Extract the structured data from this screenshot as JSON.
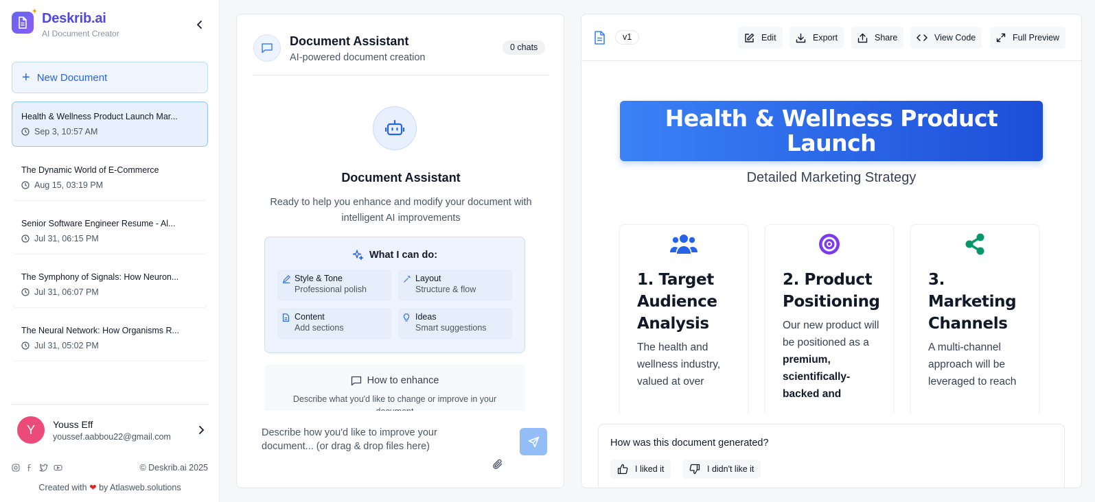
{
  "brand": {
    "name": "Deskrib.ai",
    "tagline": "AI Document Creator"
  },
  "sidebar": {
    "new_document_label": "New Document",
    "documents": [
      {
        "title": "Health & Wellness Product Launch Mar...",
        "date": "Sep 3, 10:57 AM"
      },
      {
        "title": "The Dynamic World of E-Commerce",
        "date": "Aug 15, 03:19 PM"
      },
      {
        "title": "Senior Software Engineer Resume - Al...",
        "date": "Jul 31, 06:15 PM"
      },
      {
        "title": "The Symphony of Signals: How Neuron...",
        "date": "Jul 31, 06:07 PM"
      },
      {
        "title": "The Neural Network: How Organisms R...",
        "date": "Jul 31, 05:02 PM"
      }
    ],
    "user": {
      "initial": "Y",
      "name": "Youss Eff",
      "email": "youssef.aabbou22@gmail.com"
    },
    "social_icons": [
      "instagram-icon",
      "facebook-icon",
      "twitter-icon",
      "youtube-icon"
    ],
    "copyright": "© Deskrib.ai 2025",
    "created_prefix": "Created with",
    "created_suffix": "by Atlasweb.solutions"
  },
  "assistant": {
    "title": "Document Assistant",
    "subtitle": "AI-powered document creation",
    "chat_count": "0 chats",
    "center_title": "Document Assistant",
    "center_description": "Ready to help you enhance and modify your document with intelligent AI improvements",
    "capabilities_heading": "What I can do:",
    "capabilities": [
      {
        "title": "Style & Tone",
        "subtitle": "Professional polish"
      },
      {
        "title": "Layout",
        "subtitle": "Structure & flow"
      },
      {
        "title": "Content",
        "subtitle": "Add sections"
      },
      {
        "title": "Ideas",
        "subtitle": "Smart suggestions"
      }
    ],
    "enhance_heading": "How to enhance",
    "enhance_description": "Describe what you'd like to change or improve in your document",
    "input_placeholder": "Describe how you'd like to improve your document... (or drag & drop files here)"
  },
  "preview": {
    "version": "v1",
    "toolbar": {
      "edit": "Edit",
      "export": "Export",
      "share": "Share",
      "view_code": "View Code",
      "full_preview": "Full Preview"
    },
    "document": {
      "title": "Health & Wellness Product Launch",
      "subtitle": "Detailed Marketing Strategy",
      "sections": [
        {
          "title": "1. Target Audience Analysis",
          "text": "The health and wellness industry, valued at over"
        },
        {
          "title": "2. Product Positioning",
          "text_before": "Our new product will be positioned as a",
          "text_bold": "premium, scientifically-backed and"
        },
        {
          "title": "3. Marketing Channels",
          "text": "A multi-channel approach will be leveraged to reach"
        }
      ]
    },
    "feedback": {
      "question": "How was this document generated?",
      "like": "I liked it",
      "dislike": "I didn't like it"
    }
  },
  "colors": {
    "accent": "#2563eb",
    "brand": "#4f46e5",
    "avatar": "#ec4a78"
  }
}
